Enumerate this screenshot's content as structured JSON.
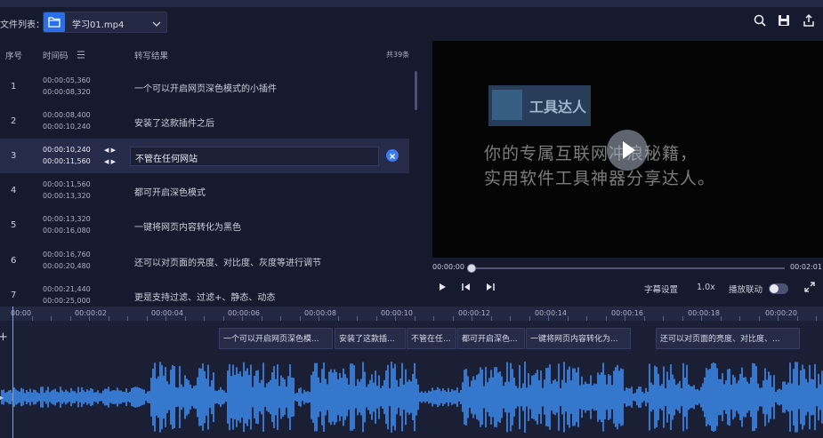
{
  "header": {
    "file_list_label": "文件列表：",
    "file_name": "学习01.mp4",
    "icons": [
      "folder-icon",
      "chevron-down-icon",
      "search-icon",
      "save-icon",
      "export-icon"
    ]
  },
  "table": {
    "col_index": "序号",
    "col_timecode": "时间码",
    "col_result": "转写结果",
    "count": "共39条",
    "rows": [
      {
        "index": "1",
        "start": "00:00:05,360",
        "end": "00:00:08,320",
        "text": "一个可以开启网页深色模式的小插件"
      },
      {
        "index": "2",
        "start": "00:00:08,400",
        "end": "00:00:10,240",
        "text": "安装了这款插件之后"
      },
      {
        "index": "3",
        "start": "00:00:10,240",
        "end": "00:00:11,560",
        "text": "不管在任何网站"
      },
      {
        "index": "4",
        "start": "00:00:11,560",
        "end": "00:00:13,320",
        "text": "都可开启深色模式"
      },
      {
        "index": "5",
        "start": "00:00:13,320",
        "end": "00:00:16,080",
        "text": "一键将网页内容转化为黑色"
      },
      {
        "index": "6",
        "start": "00:00:16,760",
        "end": "00:00:20,480",
        "text": "还可以对页面的亮度、对比度、灰度等进行调节"
      },
      {
        "index": "7",
        "start": "00:00:21,440",
        "end": "00:00:25,000",
        "text": "更是支持过滤、过滤+、静态、动态"
      }
    ]
  },
  "video": {
    "logo_text": "工具达人",
    "caption_line1": "你的专属互联网冲浪秘籍，",
    "caption_line2": "实用软件工具神器分享达人。",
    "current_time": "00:00:00",
    "duration": "00:02:01",
    "progress": 0.0
  },
  "controls": {
    "subtitle_settings": "字幕设置",
    "speed": "1.0x",
    "sync_play": "播放联动",
    "sync_play_on": false
  },
  "timeline": {
    "ticks": [
      "00:00",
      "00:00:02",
      "00:00:04",
      "00:00:06",
      "00:00:08",
      "00:00:10",
      "00:00:12",
      "00:00:14",
      "00:00:16",
      "00:00:18",
      "00:00:20"
    ],
    "clips": [
      "一个可以开启网页深色模...",
      "安装了这款插...",
      "不管在任...",
      "都可开启深色...",
      "一键将网页内容转化为...",
      "还可以对页面的亮度、对比度、..."
    ]
  },
  "colors": {
    "accent": "#2b6fe8",
    "background": "#161a2e",
    "waveform": "#3d8ef5"
  }
}
